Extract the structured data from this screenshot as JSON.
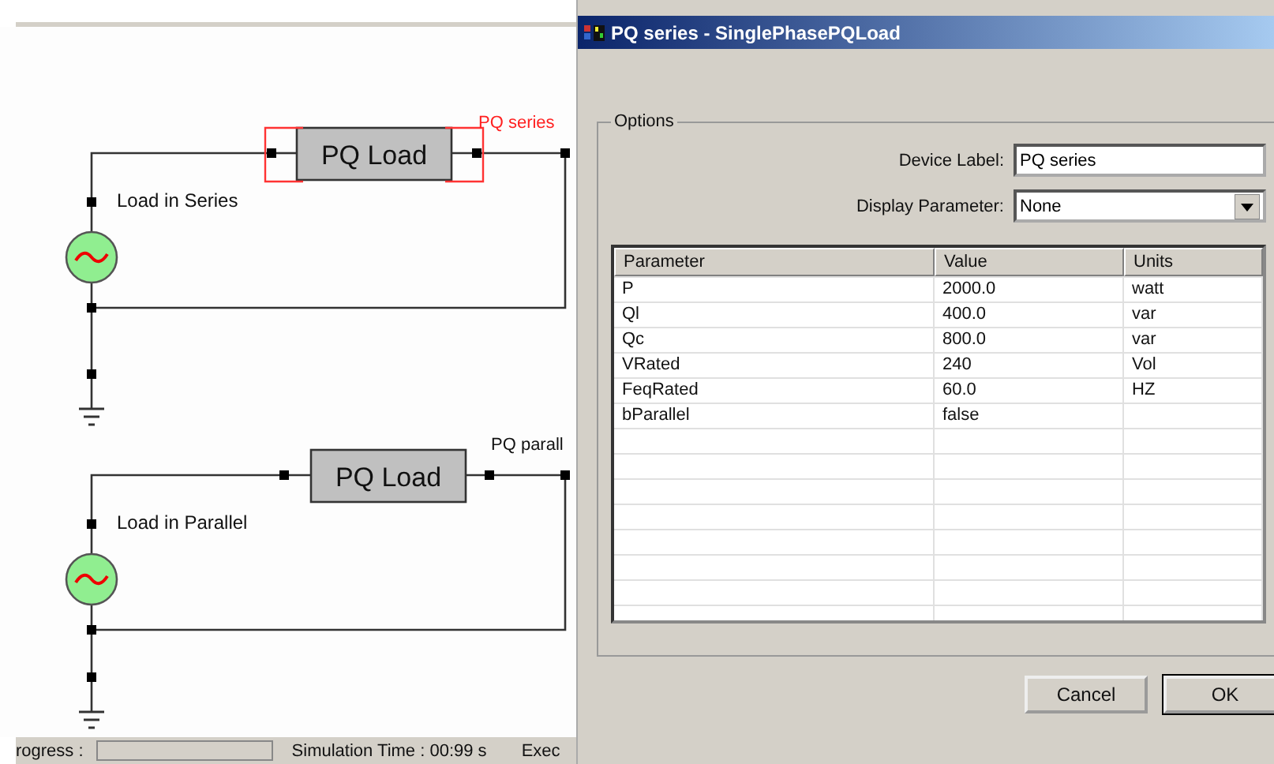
{
  "schematic": {
    "circuits": [
      {
        "caption": "Load in  Series",
        "load_label": "PQ Load",
        "device_label": "PQ series",
        "selected": true
      },
      {
        "caption": "Load  in Parallel",
        "load_label": "PQ Load",
        "device_label": "PQ  parall",
        "selected": false
      }
    ]
  },
  "status_bar": {
    "progress_label": "rogress :",
    "simulation_time": "Simulation Time : 00:99 s",
    "exec": "Exec"
  },
  "dialog": {
    "title": "PQ series - SinglePhasePQLoad",
    "group_title": "Options",
    "device_label": {
      "label": "Device Label:",
      "value": "PQ series"
    },
    "display_parameter": {
      "label": "Display Parameter:",
      "value": "None"
    },
    "table": {
      "columns": [
        "Parameter",
        "Value",
        "Units"
      ],
      "rows": [
        [
          "P",
          "2000.0",
          "watt"
        ],
        [
          "Ql",
          "400.0",
          "var"
        ],
        [
          "Qc",
          "800.0",
          "var"
        ],
        [
          "VRated",
          "240",
          "Vol"
        ],
        [
          "FeqRated",
          "60.0",
          "HZ"
        ],
        [
          "bParallel",
          "false",
          ""
        ]
      ]
    },
    "buttons": [
      {
        "label": "Cancel",
        "default": false
      },
      {
        "label": "OK",
        "default": true
      }
    ]
  }
}
